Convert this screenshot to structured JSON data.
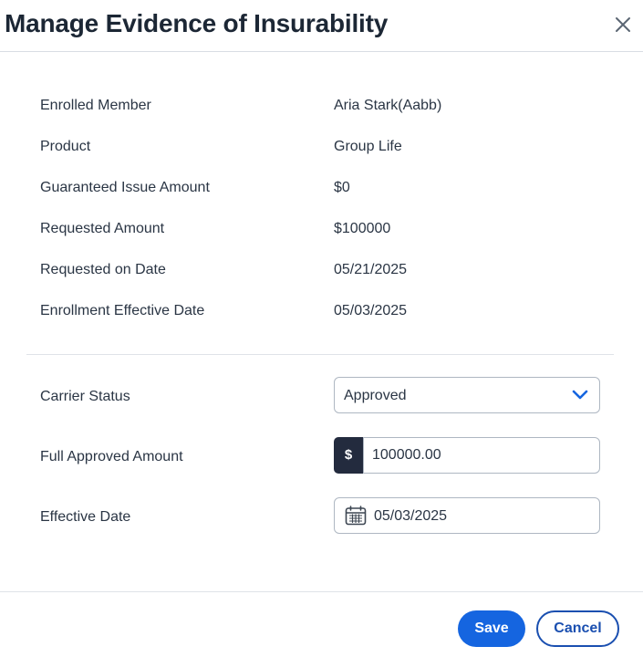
{
  "dialog": {
    "title": "Manage Evidence of Insurability",
    "close_icon": "close-icon"
  },
  "details": [
    {
      "label": "Enrolled Member",
      "value": "Aria Stark(Aabb)"
    },
    {
      "label": "Product",
      "value": "Group Life"
    },
    {
      "label": "Guaranteed Issue Amount",
      "value": "$0"
    },
    {
      "label": "Requested Amount",
      "value": "$100000"
    },
    {
      "label": "Requested on Date",
      "value": "05/21/2025"
    },
    {
      "label": "Enrollment Effective Date",
      "value": "05/03/2025"
    }
  ],
  "form": {
    "carrier_status": {
      "label": "Carrier Status",
      "value": "Approved",
      "icon": "chevron-down-icon"
    },
    "full_approved_amount": {
      "label": "Full Approved Amount",
      "prefix": "$",
      "value": "100000.00"
    },
    "effective_date": {
      "label": "Effective Date",
      "value": "05/03/2025",
      "icon": "calendar-icon"
    }
  },
  "footer": {
    "save_label": "Save",
    "cancel_label": "Cancel"
  },
  "colors": {
    "primary": "#1565e0",
    "cancel_border": "#1a4fb0",
    "prefix_bg": "#232b3e",
    "chevron": "#1565e0"
  }
}
